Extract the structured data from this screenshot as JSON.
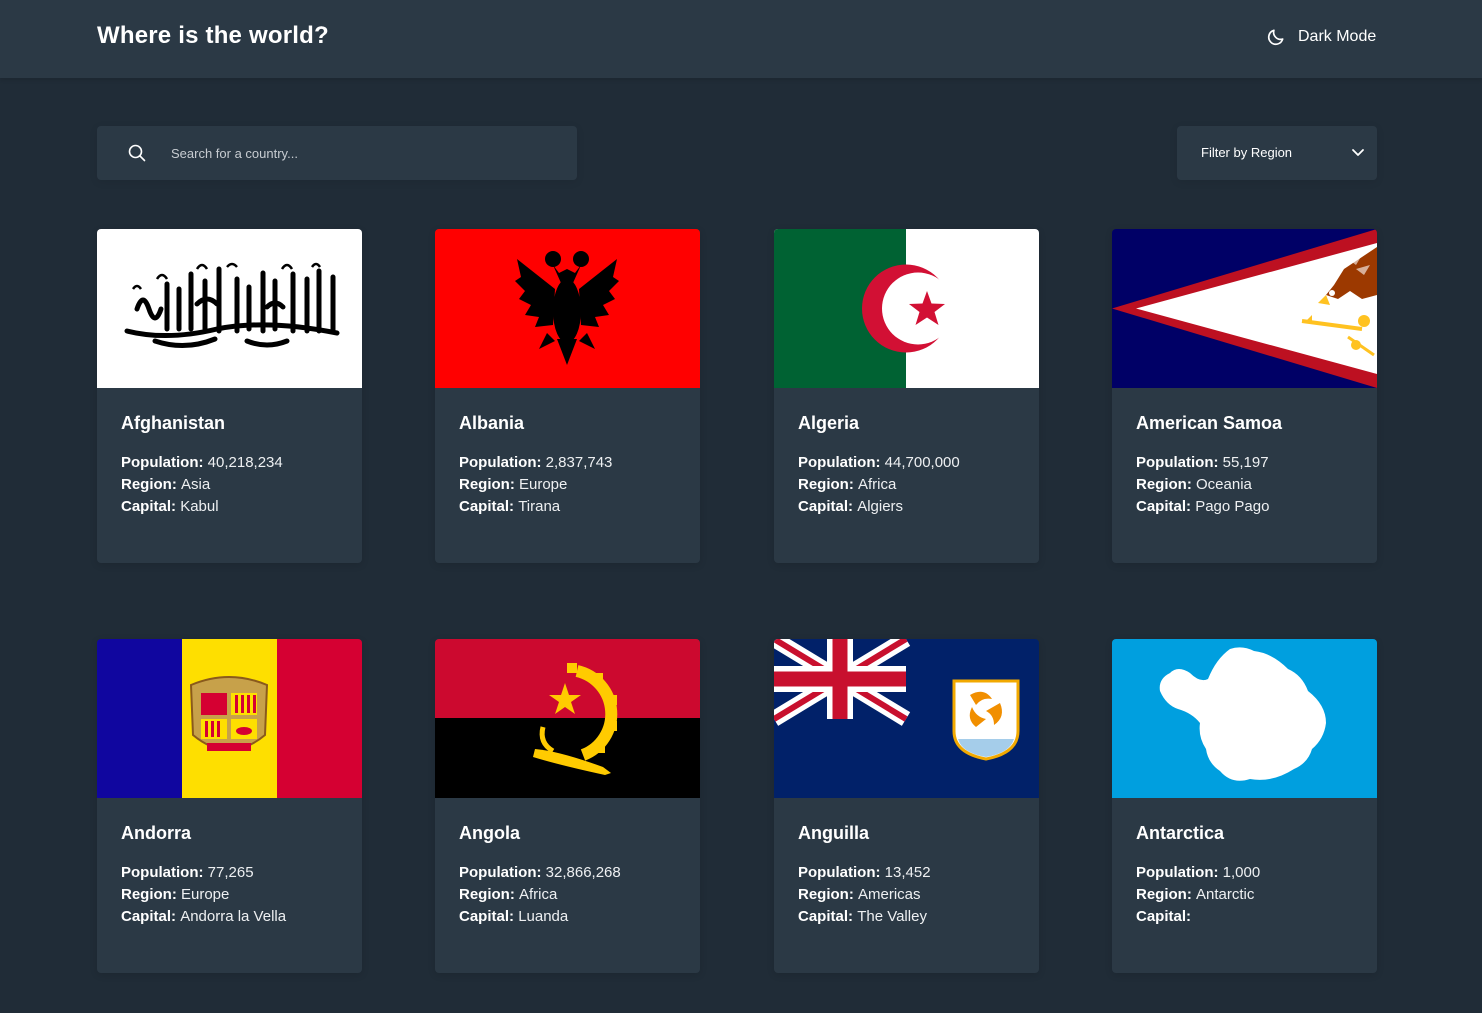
{
  "header": {
    "title": "Where is the world?",
    "mode_toggle_label": "Dark Mode",
    "mode_icon": "moon-icon"
  },
  "controls": {
    "search_placeholder": "Search for a country...",
    "search_value": "",
    "filter_label": "Filter by Region"
  },
  "labels": {
    "population": "Population:",
    "region": "Region:",
    "capital": "Capital:"
  },
  "countries": [
    {
      "name": "Afghanistan",
      "population": "40,218,234",
      "region": "Asia",
      "capital": "Kabul"
    },
    {
      "name": "Albania",
      "population": "2,837,743",
      "region": "Europe",
      "capital": "Tirana"
    },
    {
      "name": "Algeria",
      "population": "44,700,000",
      "region": "Africa",
      "capital": "Algiers"
    },
    {
      "name": "American Samoa",
      "population": "55,197",
      "region": "Oceania",
      "capital": "Pago Pago"
    },
    {
      "name": "Andorra",
      "population": "77,265",
      "region": "Europe",
      "capital": "Andorra la Vella"
    },
    {
      "name": "Angola",
      "population": "32,866,268",
      "region": "Africa",
      "capital": "Luanda"
    },
    {
      "name": "Anguilla",
      "population": "13,452",
      "region": "Americas",
      "capital": "The Valley"
    },
    {
      "name": "Antarctica",
      "population": "1,000",
      "region": "Antarctic",
      "capital": ""
    }
  ],
  "colors": {
    "background": "#202c37",
    "surface": "#2b3945",
    "text": "#ffffff"
  }
}
